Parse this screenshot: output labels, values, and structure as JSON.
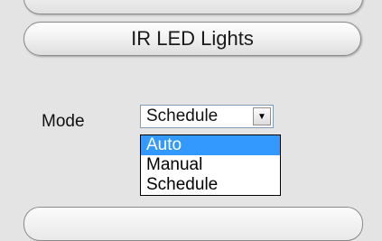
{
  "panel": {
    "section_button_label": "IR LED Lights"
  },
  "mode": {
    "label": "Mode",
    "selected_value": "Schedule",
    "dropdown_icon": "chevron-down-icon",
    "options": [
      {
        "label": "Auto",
        "highlighted": true
      },
      {
        "label": "Manual",
        "highlighted": false
      },
      {
        "label": "Schedule",
        "highlighted": false
      }
    ]
  },
  "colors": {
    "highlight": "#3399ff",
    "background": "#e4e4e4"
  }
}
